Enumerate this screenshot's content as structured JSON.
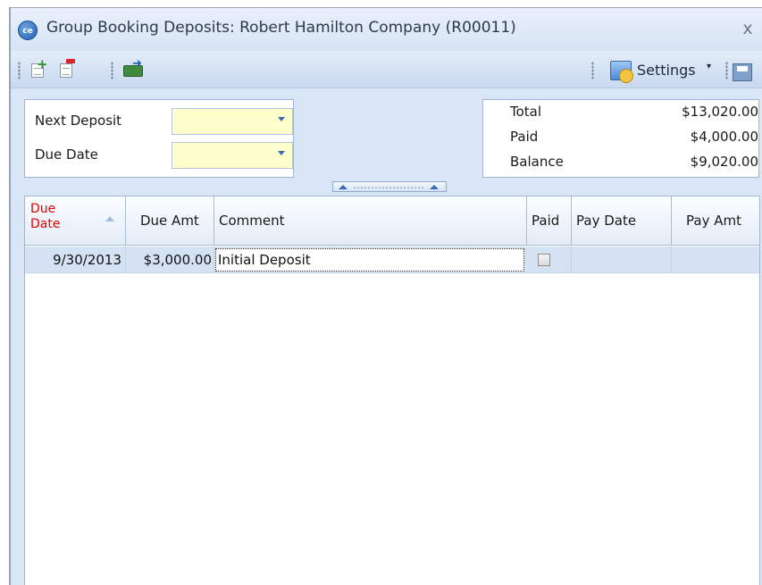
{
  "window": {
    "title": "Group Booking Deposits: Robert Hamilton Company (R00011)",
    "app_icon": "app-logo-icon",
    "close_glyph": "x"
  },
  "toolbar": {
    "add_icon": "add-deposit-icon",
    "remove_icon": "remove-deposit-icon",
    "pay_icon": "money-transfer-icon",
    "settings_label": "Settings",
    "settings_caret": "▾",
    "save_icon": "save-layout-icon"
  },
  "form": {
    "next_deposit_label": "Next Deposit",
    "next_deposit_value": "",
    "due_date_label": "Due Date",
    "due_date_value": ""
  },
  "summary": {
    "total_label": "Total",
    "total_value": "$13,020.00",
    "paid_label": "Paid",
    "paid_value": "$4,000.00",
    "balance_label": "Balance",
    "balance_value": "$9,020.00"
  },
  "grid": {
    "columns": {
      "due_date_line1": "Due",
      "due_date_line2": "Date",
      "due_amt": "Due Amt",
      "comment": "Comment",
      "paid": "Paid",
      "pay_date": "Pay Date",
      "pay_amt": "Pay Amt"
    },
    "rows": [
      {
        "due_date": "9/30/2013",
        "due_amt": "$3,000.00",
        "comment": "Initial Deposit",
        "paid": false,
        "pay_date": "",
        "pay_amt": ""
      }
    ]
  },
  "colors": {
    "accent": "#3a6cb3",
    "sorted_header": "#e30000",
    "selected_row": "#d4e2f4",
    "combo_fill": "#ffffcc"
  }
}
